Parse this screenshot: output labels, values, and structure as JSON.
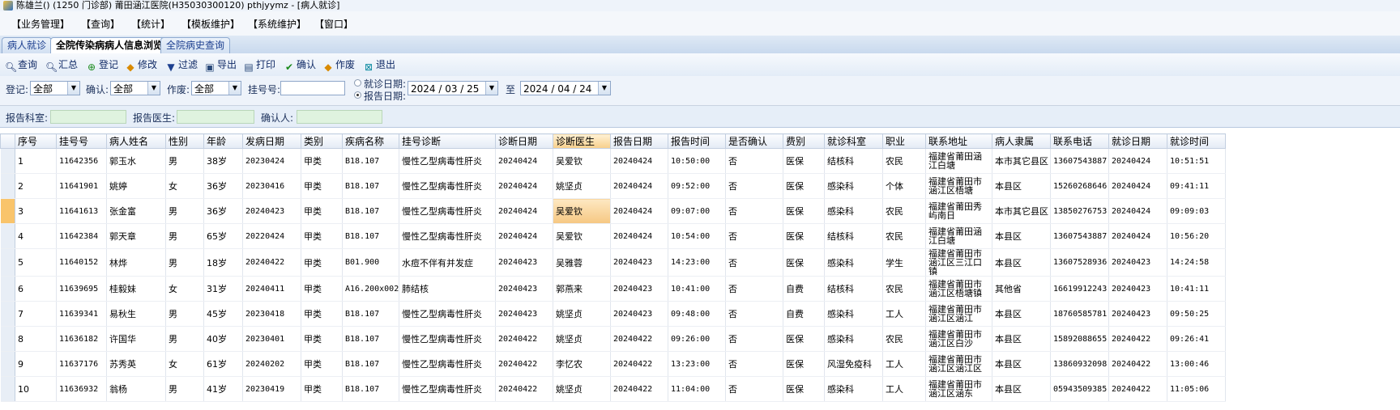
{
  "window": {
    "title": "陈雄兰() (1250 门诊部) 莆田涵江医院(H35030300120) pthjyymz - [病人就诊]"
  },
  "menu": [
    "【业务管理】",
    "【查询】",
    "【统计】",
    "【模板维护】",
    "【系统维护】",
    "【窗口】"
  ],
  "tabs": [
    "病人就诊",
    "全院传染病病人信息浏览",
    "全院病史查询"
  ],
  "active_tab": 1,
  "toolbar": {
    "query": "查询",
    "summary": "汇总",
    "register": "登记",
    "modify": "修改",
    "filter": "过滤",
    "export": "导出",
    "print": "打印",
    "confirm": "确认",
    "void": "作废",
    "exit": "退出"
  },
  "filters": {
    "register_label": "登记:",
    "register_value": "全部",
    "confirm_label": "确认:",
    "confirm_value": "全部",
    "void_label": "作废:",
    "void_value": "全部",
    "regno_label": "挂号号:",
    "regno_value": "",
    "visit_date_label": "就诊日期:",
    "report_date_label": "报告日期:",
    "date_from": "2024 / 03 / 25",
    "to_label": "至",
    "date_to": "2024 / 04 / 24",
    "selected_date_type": "报告日期",
    "report_dept_label": "报告科室:",
    "report_doctor_label": "报告医生:",
    "confirmer_label": "确认人:"
  },
  "table": {
    "columns": [
      "序号",
      "挂号号",
      "病人姓名",
      "性别",
      "年龄",
      "发病日期",
      "类别",
      "疾病名称",
      "挂号诊断",
      "诊断日期",
      "诊断医生",
      "报告日期",
      "报告时间",
      "是否确认",
      "费别",
      "就诊科室",
      "职业",
      "联系地址",
      "病人隶属",
      "联系电话",
      "就诊日期",
      "就诊时间"
    ],
    "highlighted_column": "诊断医生",
    "current_row_index": 2,
    "rows": [
      [
        "1",
        "11642356",
        "郭玉水",
        "男",
        "38岁",
        "20230424",
        "甲类",
        "B18.107",
        "慢性乙型病毒性肝炎",
        "20240424",
        "吴爱钦",
        "20240424",
        "10:50:00",
        "否",
        "医保",
        "结核科",
        "农民",
        "福建省莆田涵江白塘",
        "本市其它县区",
        "13607543887",
        "20240424",
        "10:51:51"
      ],
      [
        "2",
        "11641901",
        "姚婷",
        "女",
        "36岁",
        "20230416",
        "甲类",
        "B18.107",
        "慢性乙型病毒性肝炎",
        "20240424",
        "姚坚贞",
        "20240424",
        "09:52:00",
        "否",
        "医保",
        "感染科",
        "个体",
        "福建省莆田市涵江区梧塘",
        "本县区",
        "15260268646",
        "20240424",
        "09:41:11"
      ],
      [
        "3",
        "11641613",
        "张金富",
        "男",
        "36岁",
        "20240423",
        "甲类",
        "B18.107",
        "慢性乙型病毒性肝炎",
        "20240424",
        "吴爱钦",
        "20240424",
        "09:07:00",
        "否",
        "医保",
        "感染科",
        "农民",
        "福建省莆田秀屿南日",
        "本市其它县区",
        "13850276753",
        "20240424",
        "09:09:03"
      ],
      [
        "4",
        "11642384",
        "郭天章",
        "男",
        "65岁",
        "20220424",
        "甲类",
        "B18.107",
        "慢性乙型病毒性肝炎",
        "20240424",
        "吴爱钦",
        "20240424",
        "10:54:00",
        "否",
        "医保",
        "结核科",
        "农民",
        "福建省莆田涵江白塘",
        "本县区",
        "13607543887",
        "20240424",
        "10:56:20"
      ],
      [
        "5",
        "11640152",
        "林烨",
        "男",
        "18岁",
        "20240422",
        "甲类",
        "B01.900",
        "水痘不伴有并发症",
        "20240423",
        "吴雅蓉",
        "20240423",
        "14:23:00",
        "否",
        "医保",
        "感染科",
        "学生",
        "福建省莆田市涵江区三江口镇",
        "本县区",
        "13607528936",
        "20240423",
        "14:24:58"
      ],
      [
        "6",
        "11639695",
        "桂毅妹",
        "女",
        "31岁",
        "20240411",
        "甲类",
        "A16.200x002",
        "肺结核",
        "20240423",
        "郭燕来",
        "20240423",
        "10:41:00",
        "否",
        "自费",
        "结核科",
        "农民",
        "福建省莆田市涵江区梧塘镇",
        "其他省",
        "16619912243",
        "20240423",
        "10:41:11"
      ],
      [
        "7",
        "11639341",
        "易秋生",
        "男",
        "45岁",
        "20230418",
        "甲类",
        "B18.107",
        "慢性乙型病毒性肝炎",
        "20240423",
        "姚坚贞",
        "20240423",
        "09:48:00",
        "否",
        "自费",
        "感染科",
        "工人",
        "福建省莆田市涵江区涵江",
        "本县区",
        "18760585781",
        "20240423",
        "09:50:25"
      ],
      [
        "8",
        "11636182",
        "许国华",
        "男",
        "40岁",
        "20230401",
        "甲类",
        "B18.107",
        "慢性乙型病毒性肝炎",
        "20240422",
        "姚坚贞",
        "20240422",
        "09:26:00",
        "否",
        "医保",
        "感染科",
        "农民",
        "福建省莆田市涵江区白沙",
        "本县区",
        "15892088655",
        "20240422",
        "09:26:41"
      ],
      [
        "9",
        "11637176",
        "苏秀英",
        "女",
        "61岁",
        "20240202",
        "甲类",
        "B18.107",
        "慢性乙型病毒性肝炎",
        "20240422",
        "李忆农",
        "20240422",
        "13:23:00",
        "否",
        "医保",
        "风湿免疫科",
        "工人",
        "福建省莆田市涵江区涵江区",
        "本县区",
        "13860932098",
        "20240422",
        "13:00:46"
      ],
      [
        "10",
        "11636932",
        "翁杨",
        "男",
        "41岁",
        "20230419",
        "甲类",
        "B18.107",
        "慢性乙型病毒性肝炎",
        "20240422",
        "姚坚贞",
        "20240422",
        "11:04:00",
        "否",
        "医保",
        "感染科",
        "工人",
        "福建省莆田市涵江区涵东",
        "本县区",
        "05943509385",
        "20240422",
        "11:05:06"
      ]
    ]
  }
}
